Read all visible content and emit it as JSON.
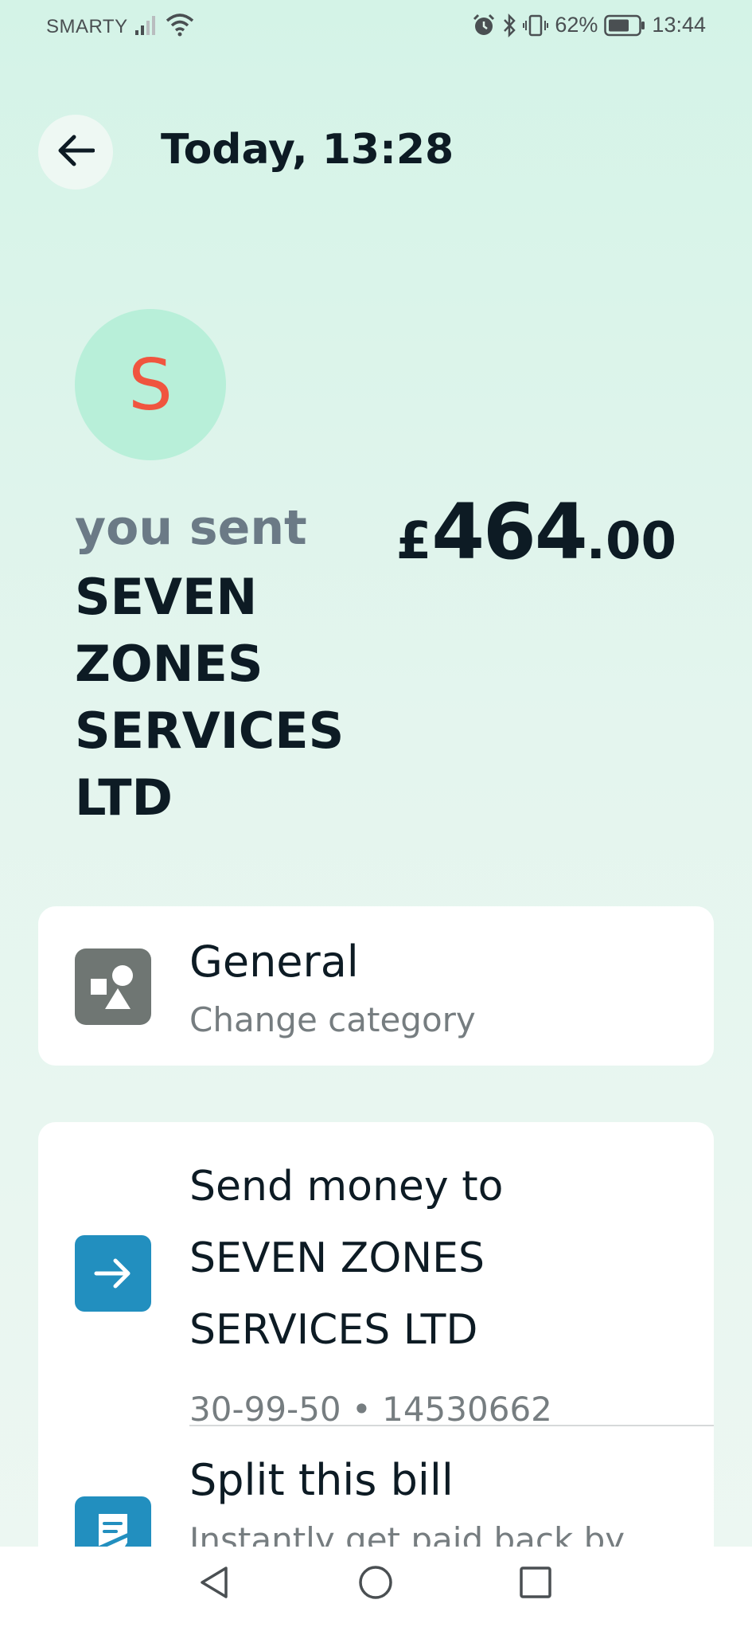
{
  "status_bar": {
    "carrier": "SMARTY",
    "battery_percent": "62%",
    "time": "13:44"
  },
  "header": {
    "title": "Today, 13:28"
  },
  "transaction": {
    "avatar_letter": "S",
    "direction_label": "you sent",
    "payee_lines": [
      "SEVEN",
      "ZONES",
      "SERVICES",
      "LTD"
    ],
    "amount_currency": "£",
    "amount_whole": "464",
    "amount_decimal": ".00"
  },
  "category": {
    "title": "General",
    "subtitle": "Change category"
  },
  "send_money": {
    "lines": [
      "Send money to",
      "SEVEN ZONES",
      "SERVICES LTD"
    ],
    "account": "30-99-50 • 14530662"
  },
  "split_bill": {
    "title": "Split this bill",
    "subtitle": "Instantly get paid back by"
  },
  "colors": {
    "accent_blue": "#228fbf",
    "avatar_bg": "#b8efd9",
    "avatar_letter": "#f0553f",
    "category_icon_bg": "#6f7673"
  }
}
